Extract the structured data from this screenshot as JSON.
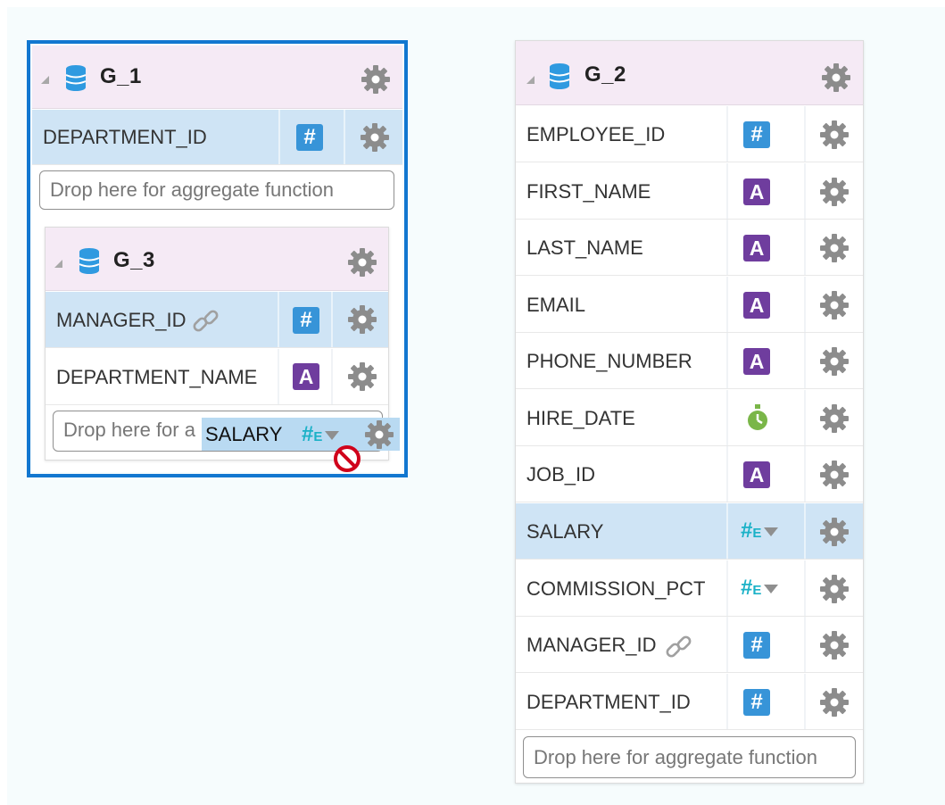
{
  "g1": {
    "title": "G_1",
    "rows": [
      {
        "name": "DEPARTMENT_ID",
        "type": "number-icon"
      }
    ],
    "drop_placeholder": "Drop here for aggregate function"
  },
  "g3": {
    "title": "G_3",
    "rows": [
      {
        "name": "MANAGER_ID",
        "type": "number-icon",
        "linked": true
      },
      {
        "name": "DEPARTMENT_NAME",
        "type": "string-icon"
      }
    ],
    "drop_placeholder_partial": "Drop here for a"
  },
  "drag": {
    "label": "SALARY",
    "type_glyph": "#",
    "type_suffix": "E",
    "status_icon": "no-drop-icon"
  },
  "g2": {
    "title": "G_2",
    "rows": [
      {
        "name": "EMPLOYEE_ID",
        "type": "number-icon"
      },
      {
        "name": "FIRST_NAME",
        "type": "string-icon"
      },
      {
        "name": "LAST_NAME",
        "type": "string-icon"
      },
      {
        "name": "EMAIL",
        "type": "string-icon"
      },
      {
        "name": "PHONE_NUMBER",
        "type": "string-icon"
      },
      {
        "name": "HIRE_DATE",
        "type": "date-icon"
      },
      {
        "name": "JOB_ID",
        "type": "string-icon"
      },
      {
        "name": "SALARY",
        "type": "measure-icon",
        "highlighted": true
      },
      {
        "name": "COMMISSION_PCT",
        "type": "measure-icon"
      },
      {
        "name": "MANAGER_ID",
        "type": "number-icon",
        "linked": true
      },
      {
        "name": "DEPARTMENT_ID",
        "type": "number-icon"
      }
    ],
    "drop_placeholder": "Drop here for aggregate function"
  },
  "glyphs": {
    "number": "#",
    "string": "A",
    "measure_hash": "#",
    "measure_e": "E"
  },
  "colors": {
    "selection_outline": "#1277d0",
    "header_bg": "#f5eaf5",
    "highlight_row": "#cfe4f5",
    "number_type": "#3794d8",
    "string_type": "#6f3d9e",
    "measure_type": "#1ab1c7",
    "date_type": "#7ab648",
    "gear": "#8c8c8c",
    "no_drop": "#d0021b"
  }
}
